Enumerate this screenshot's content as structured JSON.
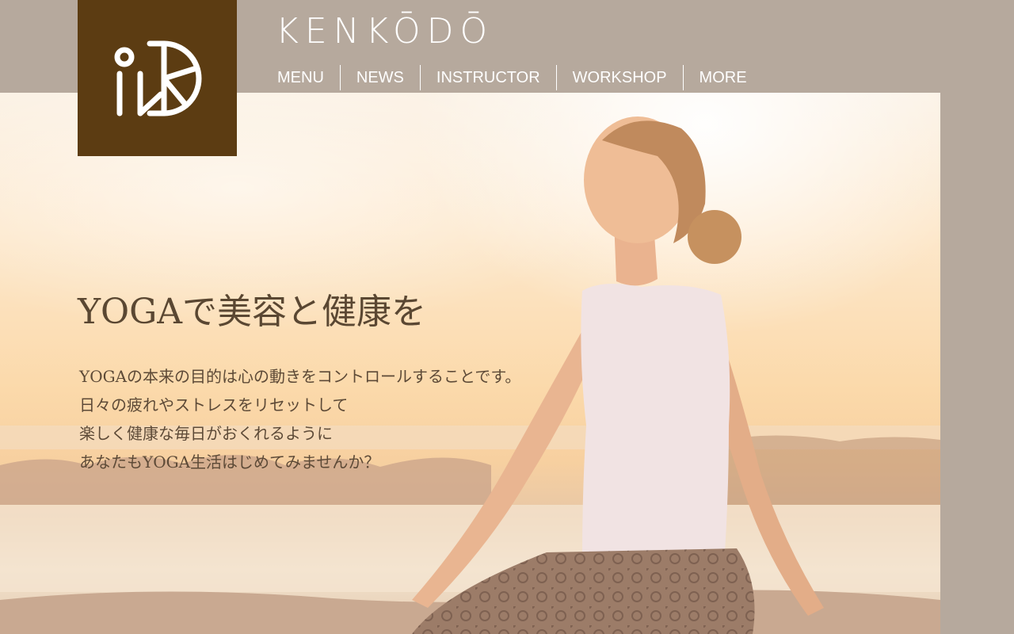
{
  "brand": {
    "name": "KENKŌDŌ",
    "logo_icon": "kenkodo-logo-icon",
    "logo_color": "#5c3c12"
  },
  "nav": {
    "items": [
      {
        "label": "MENU"
      },
      {
        "label": "NEWS"
      },
      {
        "label": "INSTRUCTOR"
      },
      {
        "label": "WORKSHOP"
      },
      {
        "label": "MORE"
      }
    ]
  },
  "hero": {
    "heading": "YOGAで美容と健康を",
    "lines": [
      "YOGAの本来の目的は心の動きをコントロールすることです。",
      "日々の疲れやストレスをリセットして",
      "楽しく健康な毎日がおくれるように",
      "あなたもYOGA生活はじめてみませんか？"
    ],
    "image": "yoga-woman-beach-sunset-photo"
  },
  "colors": {
    "header_bg": "#b6a99d",
    "text_brown": "#5a4732",
    "nav_text": "#ffffff"
  }
}
